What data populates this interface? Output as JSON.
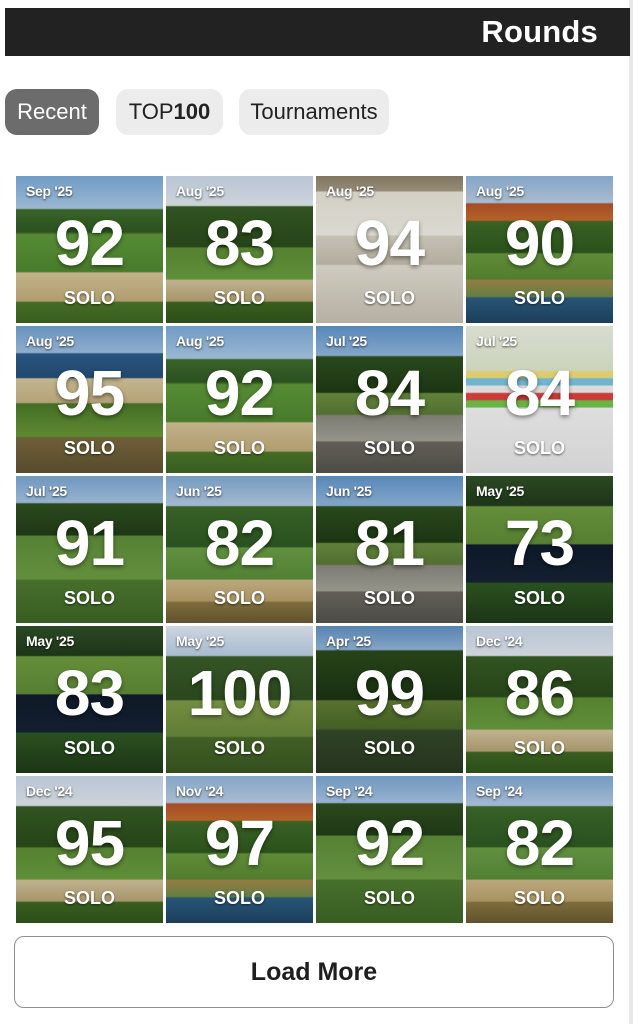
{
  "header": {
    "title": "Rounds"
  },
  "tabs": [
    {
      "label": "Recent"
    },
    {
      "label_prefix": "TOP",
      "label_bold": "100"
    },
    {
      "label": "Tournaments"
    }
  ],
  "tiles": [
    {
      "date": "Sep '25",
      "score": "92",
      "mode": "SOLO",
      "image": "course"
    },
    {
      "date": "Aug '25",
      "score": "83",
      "mode": "SOLO",
      "image": "trees"
    },
    {
      "date": "Aug '25",
      "score": "94",
      "mode": "SOLO",
      "image": "card"
    },
    {
      "date": "Aug '25",
      "score": "90",
      "mode": "SOLO",
      "image": "autumn"
    },
    {
      "date": "Aug '25",
      "score": "95",
      "mode": "SOLO",
      "image": "water"
    },
    {
      "date": "Aug '25",
      "score": "92",
      "mode": "SOLO",
      "image": "course"
    },
    {
      "date": "Jul '25",
      "score": "84",
      "mode": "SOLO",
      "image": "rock"
    },
    {
      "date": "Jul '25",
      "score": "84",
      "mode": "SOLO",
      "image": "scorecard"
    },
    {
      "date": "Jul '25",
      "score": "91",
      "mode": "SOLO",
      "image": "fairway"
    },
    {
      "date": "Jun '25",
      "score": "82",
      "mode": "SOLO",
      "image": "tallgrass"
    },
    {
      "date": "Jun '25",
      "score": "81",
      "mode": "SOLO",
      "image": "rock"
    },
    {
      "date": "May '25",
      "score": "73",
      "mode": "SOLO",
      "image": "pond"
    },
    {
      "date": "May '25",
      "score": "83",
      "mode": "SOLO",
      "image": "pond"
    },
    {
      "date": "May '25",
      "score": "100",
      "mode": "SOLO",
      "image": "cloudy"
    },
    {
      "date": "Apr '25",
      "score": "99",
      "mode": "SOLO",
      "image": "dark"
    },
    {
      "date": "Dec '24",
      "score": "86",
      "mode": "SOLO",
      "image": "trees"
    },
    {
      "date": "Dec '24",
      "score": "95",
      "mode": "SOLO",
      "image": "trees"
    },
    {
      "date": "Nov '24",
      "score": "97",
      "mode": "SOLO",
      "image": "autumn"
    },
    {
      "date": "Sep '24",
      "score": "92",
      "mode": "SOLO",
      "image": "fairway"
    },
    {
      "date": "Sep '24",
      "score": "82",
      "mode": "SOLO",
      "image": "tallgrass"
    }
  ],
  "load_more": {
    "label": "Load More"
  }
}
